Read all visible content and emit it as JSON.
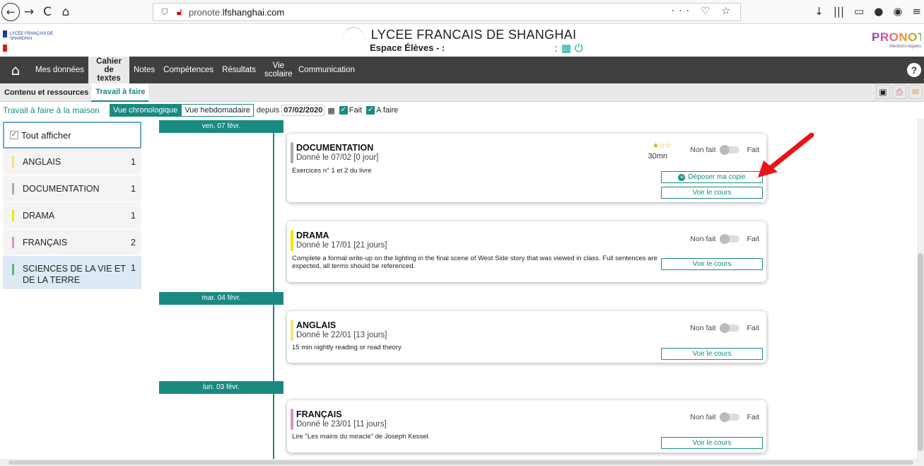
{
  "browser": {
    "url_prefix": "pronote.",
    "url_domain": "lfshanghai.com",
    "back": "←",
    "forward": "→",
    "reload": "C",
    "home": "⌂",
    "url_actions": "··· ♡ ☆",
    "toolbar_icons": [
      "↓",
      "|||",
      "▭",
      "●",
      "◉",
      "≡"
    ]
  },
  "header": {
    "logo_text": "LYCÉE FRANÇAIS DE SHANGHAI",
    "title": "LYCEE FRANCAIS DE SHANGHAI",
    "subtitle": "Espace Élèves - :",
    "pronote": "PRONOTE",
    "mentions": "Mentions légales",
    "icons": ": ▦ ⏻"
  },
  "menu": {
    "items": [
      "Mes données",
      "Cahier de textes",
      "Notes",
      "Compétences",
      "Résultats",
      "Vie scolaire",
      "Communication"
    ],
    "help": "?"
  },
  "subtabs": [
    "Contenu et ressources",
    "Travail à faire"
  ],
  "filter": {
    "section_title": "Travail à faire à la maison",
    "view_chrono": "Vue chronologique",
    "view_weekly": "Vue hebdomadaire",
    "depuis": "depuis",
    "date": "07/02/2020",
    "fait": "Fait",
    "a_faire": "A faire"
  },
  "sidebar": {
    "show_all": "Tout afficher",
    "subjects": [
      {
        "name": "ANGLAIS",
        "count": "1",
        "color": "#f3e27a"
      },
      {
        "name": "DOCUMENTATION",
        "count": "1",
        "color": "#aaaaaa"
      },
      {
        "name": "DRAMA",
        "count": "1",
        "color": "#f5e400"
      },
      {
        "name": "FRANÇAIS",
        "count": "2",
        "color": "#d792c9"
      },
      {
        "name": "SCIENCES DE LA VIE ET DE LA TERRE",
        "count": "1",
        "color": "#5bb880"
      }
    ]
  },
  "timeline": {
    "dates": [
      "ven. 07 févr.",
      "mar. 04 févr.",
      "lun. 03 févr."
    ]
  },
  "cards": [
    {
      "subject": "DOCUMENTATION",
      "given": "Donné le 07/02 [0 jour]",
      "description": "Exercices n° 1 et 2 du livre",
      "difficulty_stars": "★☆☆",
      "duration": "30mn",
      "status_left": "Non fait",
      "status_right": "Fait",
      "upload_label": "Déposer ma copie",
      "course_label": "Voir le cours",
      "accent": "#aaaaaa"
    },
    {
      "subject": "DRAMA",
      "given": "Donné le 17/01 [21 jours]",
      "description": "Complete a formal write-up on the lighting in the final scene of West Side story that was viewed in class. Full sentences are expected, all terms should be referenced.",
      "status_left": "Non fait",
      "status_right": "Fait",
      "course_label": "Voir le cours",
      "accent": "#f5e400"
    },
    {
      "subject": "ANGLAIS",
      "given": "Donné le 22/01 [13 jours]",
      "description": "15 min nightly reading or read theory",
      "status_left": "Non fait",
      "status_right": "Fait",
      "course_label": "Voir le cours",
      "accent": "#f3e27a"
    },
    {
      "subject": "FRANÇAIS",
      "given": "Donné le 23/01 [11 jours]",
      "description": "Lire \"Les mains du miracle\" de Joseph Kessel.",
      "status_left": "Non fait",
      "status_right": "Fait",
      "course_label": "Voir le cours",
      "accent": "#d792c9"
    }
  ],
  "colors": {
    "accent": "#1a8a80",
    "menu_bg": "#404040",
    "arrow": "#e8141a"
  }
}
